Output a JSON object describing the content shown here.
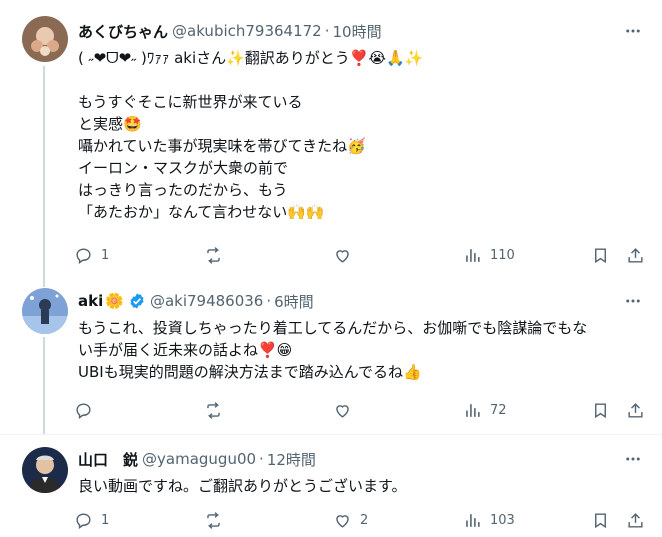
{
  "tweets": [
    {
      "name": "あくびちゃん",
      "handle": "@akubich79364172",
      "dot": "·",
      "time": "10時間",
      "lines": [
        "( ˶❤︎ᗜ❤︎˶ )ﾜｧｧ akiさん✨翻訳ありがとう❣️😭🙏✨",
        "",
        "もうすぐそこに新世界が来ている",
        "と実感🤩",
        "囁かれていた事が現実味を帯びてきたね🥳",
        "イーロン・マスクが大衆の前で",
        "はっきり言ったのだから、もう",
        "「あたおか」なんて言わせない🙌🙌"
      ],
      "reply_count": "1",
      "retweet_count": "",
      "like_count": "",
      "view_count": "110"
    },
    {
      "name": "aki",
      "name_emoji": "🌼",
      "handle": "@aki79486036",
      "dot": "·",
      "time": "6時間",
      "lines": [
        "もうこれ、投資しちゃったり着工してるんだから、お伽噺でも陰謀論でもな",
        "い手が届く近未来の話よね❣️😁",
        "UBIも現実的問題の解決方法まで踏み込んでるね👍"
      ],
      "reply_count": "",
      "retweet_count": "",
      "like_count": "",
      "view_count": "72"
    },
    {
      "name": "山口　鋭",
      "handle": "@yamagugu00",
      "dot": "·",
      "time": "12時間",
      "lines": [
        "良い動画ですね。ご翻訳ありがとうございます。"
      ],
      "reply_count": "1",
      "retweet_count": "",
      "like_count": "2",
      "view_count": "103"
    }
  ],
  "icons": [
    "more-icon",
    "reply-icon",
    "retweet-icon",
    "like-icon",
    "views-icon",
    "bookmark-icon",
    "share-icon",
    "verified-icon"
  ],
  "colors": {
    "text": "#0f1419",
    "secondary": "#536471",
    "verified": "#1d9bf0",
    "thread_line": "#cfd9de"
  }
}
